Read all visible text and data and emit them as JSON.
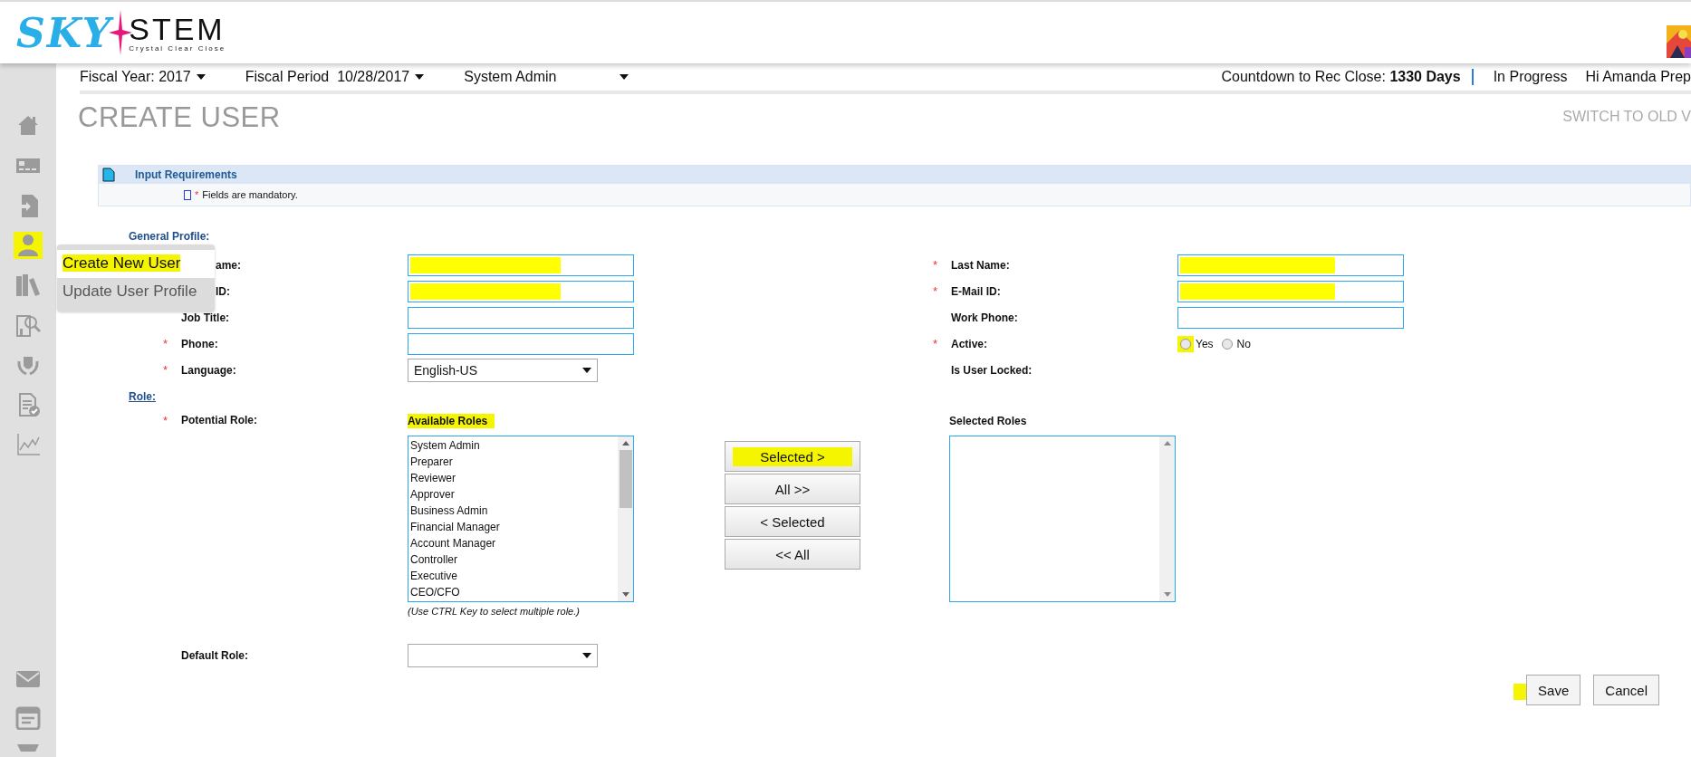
{
  "logo": {
    "brand": "SKY",
    "brand_2": "STEM",
    "tagline": "Crystal Clear Close"
  },
  "sidebar": {
    "items": [
      {
        "highlighted": false
      },
      {
        "highlighted": false
      },
      {
        "highlighted": false
      },
      {
        "highlighted": true
      },
      {
        "highlighted": false
      },
      {
        "highlighted": false
      },
      {
        "highlighted": false
      },
      {
        "highlighted": false
      },
      {
        "highlighted": false
      }
    ],
    "bottom_items": [
      {
        "highlighted": false
      },
      {
        "highlighted": false
      },
      {
        "highlighted": false
      }
    ]
  },
  "flyout_menu": [
    {
      "label": "Create New User",
      "selected": true,
      "highlighted": true
    },
    {
      "label": "Update User Profile",
      "selected": false,
      "highlighted": false
    }
  ],
  "top_bar": {
    "fiscal_year": "Fiscal Year: 2017",
    "fiscal_period_label": "Fiscal Period",
    "fiscal_period_value": "10/28/2017",
    "role": "System Admin",
    "countdown_label": "Countdown to Rec Close:",
    "countdown_value": "1330 Days",
    "status": "In Progress",
    "greeting": "Hi Amanda Prep"
  },
  "page_title": "CREATE USER",
  "switch_link": "SWITCH TO OLD V",
  "input_requirements": {
    "title": "Input Requirements",
    "mark": "*",
    "note": "Fields are mandatory."
  },
  "general_profile": "General Profile:",
  "left_fields": [
    {
      "label": "ame:",
      "required": false,
      "kind": "text",
      "highlighted": true
    },
    {
      "label": "ID:",
      "required": false,
      "kind": "text",
      "highlighted": true
    },
    {
      "label": "Job Title:",
      "required": false,
      "kind": "text",
      "highlighted": false
    },
    {
      "label": "Phone:",
      "required": true,
      "kind": "text",
      "highlighted": false
    },
    {
      "label": "Language:",
      "required": true,
      "kind": "select",
      "value": "English-US"
    }
  ],
  "right_fields": [
    {
      "label": "Last Name:",
      "required": true,
      "kind": "text",
      "highlighted": true
    },
    {
      "label": "E-Mail ID:",
      "required": true,
      "kind": "text",
      "highlighted": true
    },
    {
      "label": "Work Phone:",
      "required": false,
      "kind": "text",
      "highlighted": false
    },
    {
      "label": "Active:",
      "required": true,
      "kind": "radio",
      "options": [
        {
          "label": "Yes",
          "selected": false,
          "highlighted": true
        },
        {
          "label": "No",
          "selected": false,
          "highlighted": false
        }
      ]
    },
    {
      "label": "Is User Locked:",
      "required": false,
      "kind": "none"
    }
  ],
  "role_section": {
    "heading": "Role:",
    "potential_role_label": "Potential Role:",
    "required": true,
    "available": {
      "title": "Available Roles",
      "highlighted": true,
      "items": [
        "System Admin",
        "Preparer",
        "Reviewer",
        "Approver",
        "Business Admin",
        "Financial Manager",
        "Account Manager",
        "Controller",
        "Executive",
        "CEO/CFO"
      ],
      "hint": "(Use CTRL Key to select multiple role.)"
    },
    "move_buttons": [
      {
        "label": "Selected >",
        "highlighted": true
      },
      {
        "label": "All >>",
        "highlighted": false
      },
      {
        "label": "< Selected",
        "highlighted": false
      },
      {
        "label": "<< All",
        "highlighted": false
      }
    ],
    "selected": {
      "title": "Selected Roles"
    },
    "default_role_label": "Default Role:"
  },
  "actions": [
    {
      "label": "Save",
      "highlighted": true
    },
    {
      "label": "Cancel",
      "highlighted": false
    }
  ]
}
